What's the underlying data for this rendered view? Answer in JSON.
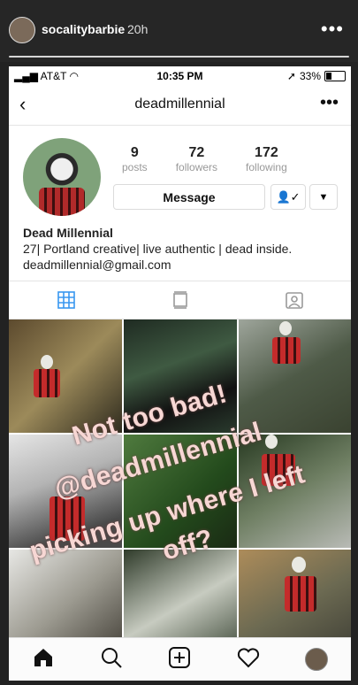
{
  "story": {
    "username": "socalitybarbie",
    "time": "20h",
    "more": "•••",
    "overlay_lines": [
      "Not too bad!",
      "@deadmillennial",
      "picking up where I left",
      "off?"
    ],
    "overlay_color": "#f7d7d4"
  },
  "status": {
    "carrier": "AT&T",
    "time": "10:35 PM",
    "battery": "33%",
    "battery_level": 0.33
  },
  "nav": {
    "back": "‹",
    "title": "deadmillennial",
    "more": "•••"
  },
  "profile": {
    "stats": [
      {
        "number": "9",
        "label": "posts"
      },
      {
        "number": "72",
        "label": "followers"
      },
      {
        "number": "172",
        "label": "following"
      }
    ],
    "message_button": "Message",
    "name": "Dead Millennial",
    "bio": "27| Portland creative| live authentic | dead inside.",
    "email": "deadmillennial@gmail.com"
  },
  "tabs": [
    "grid-icon",
    "feed-icon",
    "tagged-icon"
  ],
  "grid_count": 9,
  "bottom_nav": [
    "home-icon",
    "search-icon",
    "add-icon",
    "heart-icon",
    "profile-avatar"
  ]
}
